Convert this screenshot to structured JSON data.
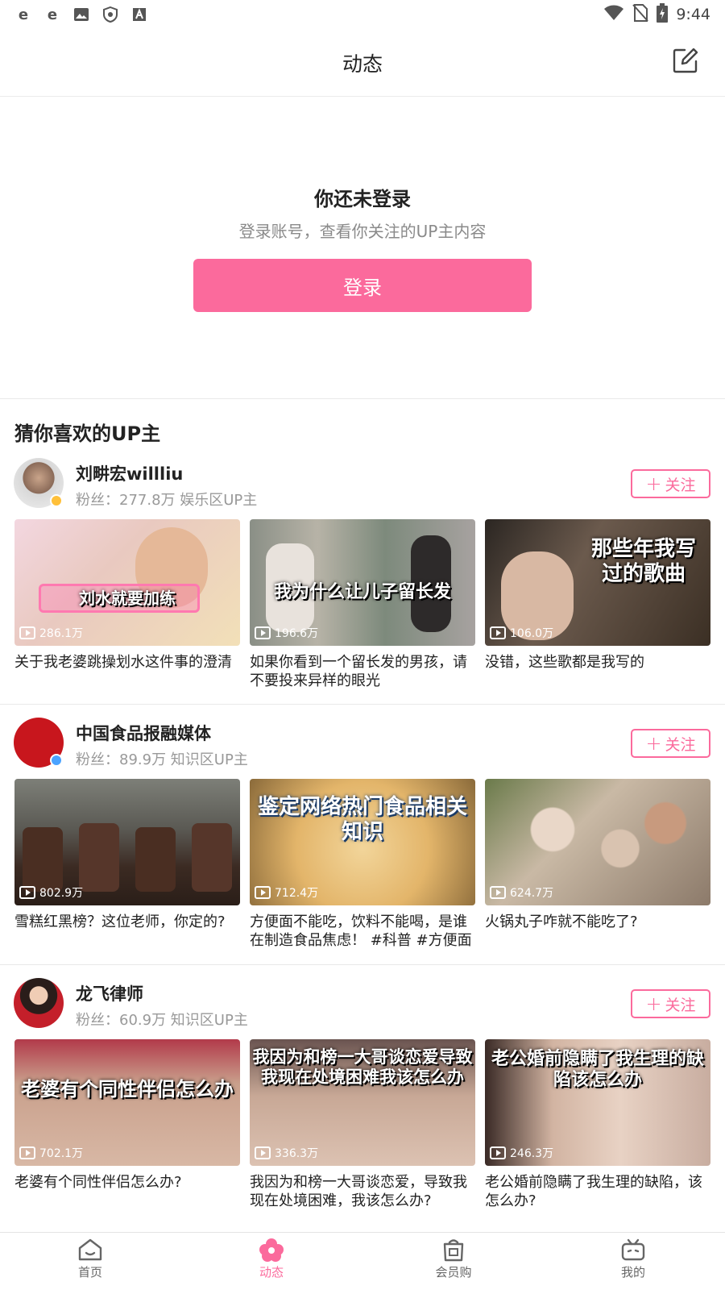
{
  "status_bar": {
    "time": "9:44",
    "left_icons": [
      "ie-icon",
      "ie-icon",
      "image-icon",
      "shield-icon",
      "a-icon"
    ]
  },
  "header": {
    "title": "动态"
  },
  "login": {
    "title": "你还未登录",
    "subtitle": "登录账号，查看你关注的UP主内容",
    "button": "登录"
  },
  "recommend": {
    "title": "猜你喜欢的UP主",
    "follow_label": "关注",
    "ups": [
      {
        "name": "刘畊宏willliu",
        "meta": "粉丝：277.8万 娱乐区UP主",
        "videos": [
          {
            "title": "关于我老婆跳操划水这件事的澄清",
            "plays": "286.1万",
            "overlay": "刘水就要加练"
          },
          {
            "title": "如果你看到一个留长发的男孩，请不要投来异样的眼光",
            "plays": "196.6万",
            "overlay": "我为什么让儿子留长发"
          },
          {
            "title": "没错，这些歌都是我写的",
            "plays": "106.0万",
            "overlay": "那些年我写过的歌曲"
          }
        ]
      },
      {
        "name": "中国食品报融媒体",
        "meta": "粉丝：89.9万 知识区UP主",
        "videos": [
          {
            "title": "雪糕红黑榜？这位老师，你定的?",
            "plays": "802.9万",
            "overlay": ""
          },
          {
            "title": "方便面不能吃，饮料不能喝，是谁在制造食品焦虑！ #科普 #方便面",
            "plays": "712.4万",
            "overlay": "鉴定网络热门食品相关知识"
          },
          {
            "title": "火锅丸子咋就不能吃了?",
            "plays": "624.7万",
            "overlay": ""
          }
        ]
      },
      {
        "name": "龙飞律师",
        "meta": "粉丝：60.9万 知识区UP主",
        "videos": [
          {
            "title": "老婆有个同性伴侣怎么办?",
            "plays": "702.1万",
            "overlay": "老婆有个同性伴侣怎么办"
          },
          {
            "title": "我因为和榜一大哥谈恋爱，导致我现在处境困难，我该怎么办?",
            "plays": "336.3万",
            "overlay": "我因为和榜一大哥谈恋爱导致我现在处境困难我该怎么办"
          },
          {
            "title": "老公婚前隐瞒了我生理的缺陷，该怎么办?",
            "plays": "246.3万",
            "overlay": "老公婚前隐瞒了我生理的缺陷该怎么办"
          }
        ]
      }
    ]
  },
  "tabbar": {
    "tabs": [
      {
        "label": "首页",
        "icon": "home-icon"
      },
      {
        "label": "动态",
        "icon": "dynamic-icon",
        "active": true
      },
      {
        "label": "会员购",
        "icon": "shop-bag-icon"
      },
      {
        "label": "我的",
        "icon": "tv-icon"
      }
    ]
  },
  "colors": {
    "accent": "#fb6a9c",
    "text": "#222222",
    "muted": "#999999"
  }
}
